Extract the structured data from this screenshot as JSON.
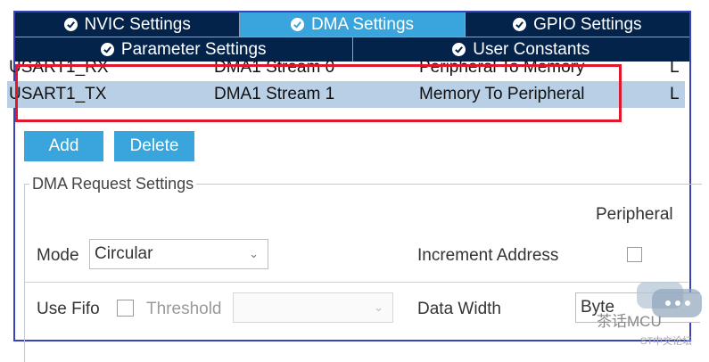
{
  "tabs_row1": [
    {
      "label": "NVIC Settings",
      "active": false
    },
    {
      "label": "DMA Settings",
      "active": true
    },
    {
      "label": "GPIO Settings",
      "active": false
    }
  ],
  "tabs_row2": [
    {
      "label": "Parameter Settings",
      "active": false
    },
    {
      "label": "User Constants",
      "active": false
    }
  ],
  "dma_table": {
    "rows": [
      {
        "request": "USART1_RX",
        "stream": "DMA1 Stream 0",
        "direction": "Peripheral To Memory",
        "priority": "L",
        "selected": false
      },
      {
        "request": "USART1_TX",
        "stream": "DMA1 Stream 1",
        "direction": "Memory To Peripheral",
        "priority": "L",
        "selected": true
      }
    ]
  },
  "buttons": {
    "add": "Add",
    "delete": "Delete"
  },
  "request_settings": {
    "title": "DMA Request Settings",
    "peripheral_label": "Peripheral",
    "mode_label": "Mode",
    "mode_value": "Circular",
    "increment_label": "Increment Address",
    "increment_checked": false,
    "use_fifo_label": "Use Fifo",
    "use_fifo_checked": false,
    "threshold_label": "Threshold",
    "threshold_value": "",
    "data_width_label": "Data Width",
    "data_width_value": "Byte"
  },
  "watermark": {
    "name": "茶话MCU",
    "sub": "ST中文论坛"
  },
  "colors": {
    "tab_bg": "#03234b",
    "tab_active": "#3aa5dc",
    "highlight": "#e0182d",
    "selected_row": "#b8cfe6",
    "frame": "#3a42b9"
  }
}
